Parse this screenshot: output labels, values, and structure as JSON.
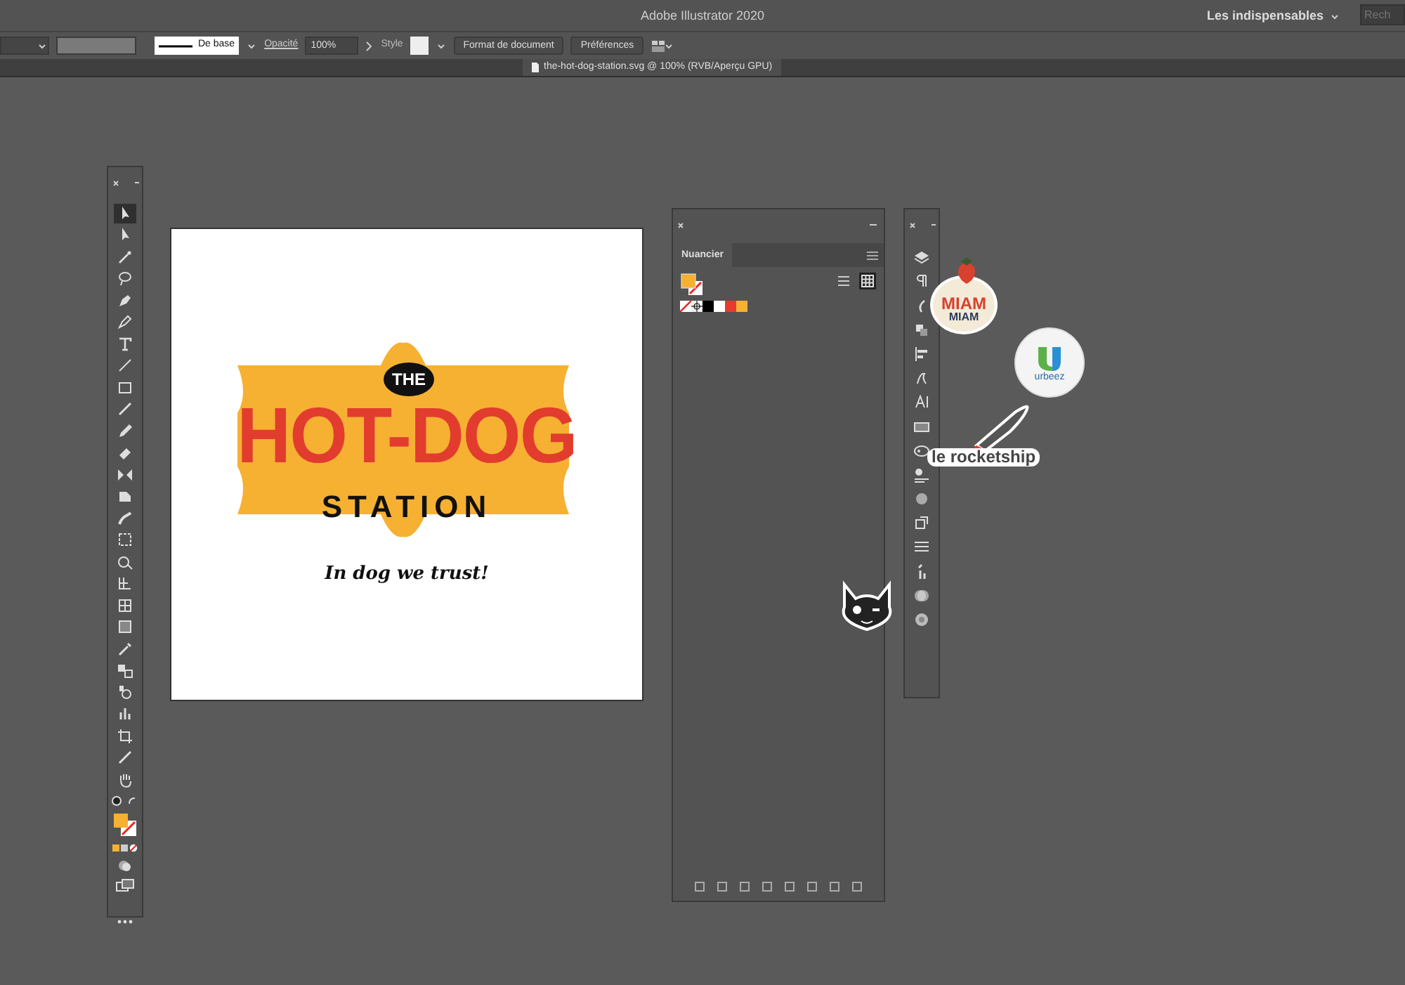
{
  "app_title": "Adobe Illustrator 2020",
  "workspace": {
    "label": "Les indispensables"
  },
  "search": {
    "placeholder": "Rech"
  },
  "control_bar": {
    "stroke_style": "De base",
    "opacity_label": "Opacité",
    "opacity_value": "100%",
    "style_label": "Style",
    "buttons": [
      "Format de document",
      "Préférences"
    ]
  },
  "document_tab": {
    "title": "the-hot-dog-station.svg @ 100% (RVB/Aperçu GPU)"
  },
  "artwork": {
    "badge": "THE",
    "headline": "HOT-DOG",
    "subline": "STATION",
    "tagline": "In dog we trust!"
  },
  "tools": [
    {
      "selected": true
    },
    {
      "selected": false
    },
    {
      "selected": false
    },
    {
      "selected": false
    },
    {
      "selected": false
    },
    {
      "selected": false
    },
    {
      "selected": false
    },
    {
      "selected": false
    },
    {
      "selected": false
    },
    {
      "selected": false
    },
    {
      "selected": false
    },
    {
      "selected": false
    },
    {
      "selected": false
    },
    {
      "selected": false
    },
    {
      "selected": false
    },
    {
      "selected": false
    },
    {
      "selected": false
    },
    {
      "selected": false
    },
    {
      "selected": false
    },
    {
      "selected": false
    },
    {
      "selected": false
    },
    {
      "selected": false
    },
    {
      "selected": false
    },
    {
      "selected": false
    },
    {
      "selected": false
    },
    {
      "selected": false
    },
    {
      "selected": false
    }
  ],
  "swatches_panel": {
    "tab": "Nuancier",
    "views": [
      {
        "kind": "list",
        "selected": false
      },
      {
        "kind": "grid",
        "selected": true
      }
    ],
    "swatches": [
      {
        "kind": "none"
      },
      {
        "kind": "registration"
      },
      {
        "kind": "color",
        "color": "#000000"
      },
      {
        "kind": "color",
        "color": "#ffffff"
      },
      {
        "kind": "color",
        "color": "#e8392f"
      },
      {
        "kind": "color",
        "color": "#f6b132"
      }
    ]
  },
  "stickers": [
    {
      "kind": "miam",
      "lines": [
        "MIAM",
        "MIAM"
      ]
    },
    {
      "kind": "urbeez",
      "lines": [
        "urbeez"
      ]
    },
    {
      "kind": "rocket",
      "lines": [
        "le rocketship"
      ]
    },
    {
      "kind": "cat"
    }
  ]
}
